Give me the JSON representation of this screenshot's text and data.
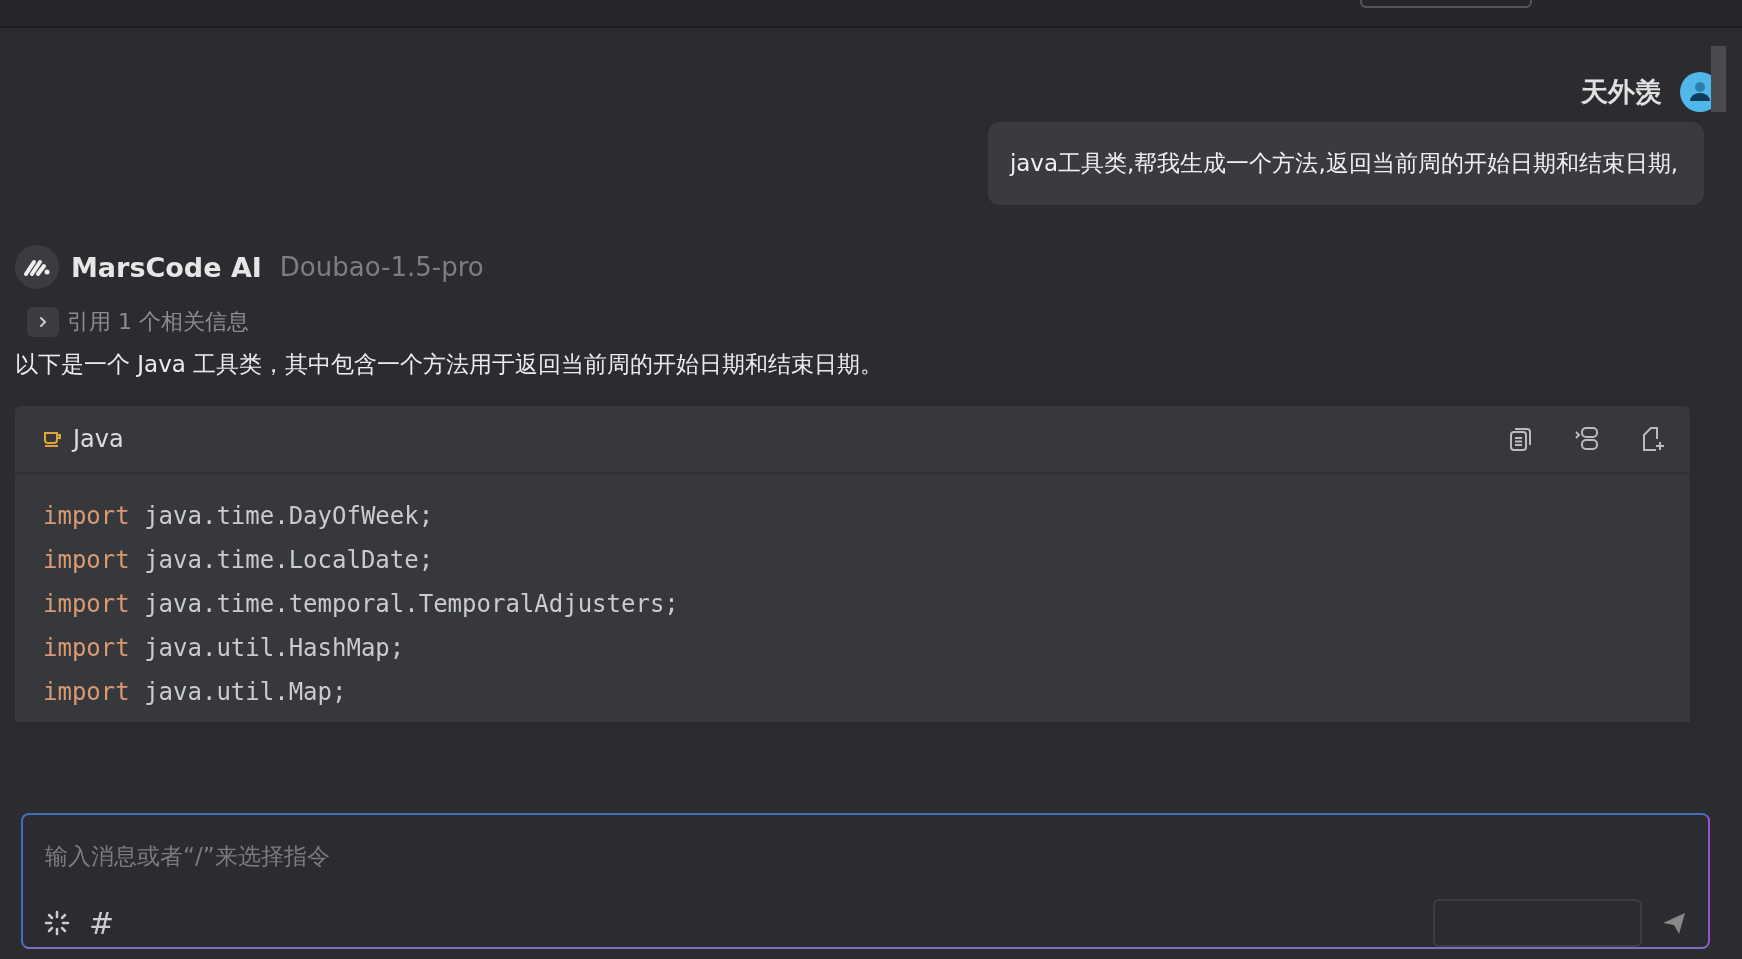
{
  "user_message": {
    "author": "天外羡",
    "text": "java工具类,帮我生成一个方法,返回当前周的开始日期和结束日期,"
  },
  "ai_message": {
    "author": "MarsCode AI",
    "model": "Doubao-1.5-pro",
    "reference": {
      "label": "引用 1 个相关信息",
      "expanded": false
    },
    "intro": "以下是一个 Java 工具类，其中包含一个方法用于返回当前周的开始日期和结束日期。",
    "code_block": {
      "language": "Java",
      "lines": [
        {
          "keyword": "import",
          "rest": "java.time.DayOfWeek;"
        },
        {
          "keyword": "import",
          "rest": "java.time.LocalDate;"
        },
        {
          "keyword": "import",
          "rest": "java.time.temporal.TemporalAdjusters;"
        },
        {
          "keyword": "import",
          "rest": "java.util.HashMap;"
        },
        {
          "keyword": "import",
          "rest": "java.util.Map;"
        }
      ]
    }
  },
  "composer": {
    "placeholder": "输入消息或者“/”来选择指令",
    "tool_icon_text": "#"
  }
}
